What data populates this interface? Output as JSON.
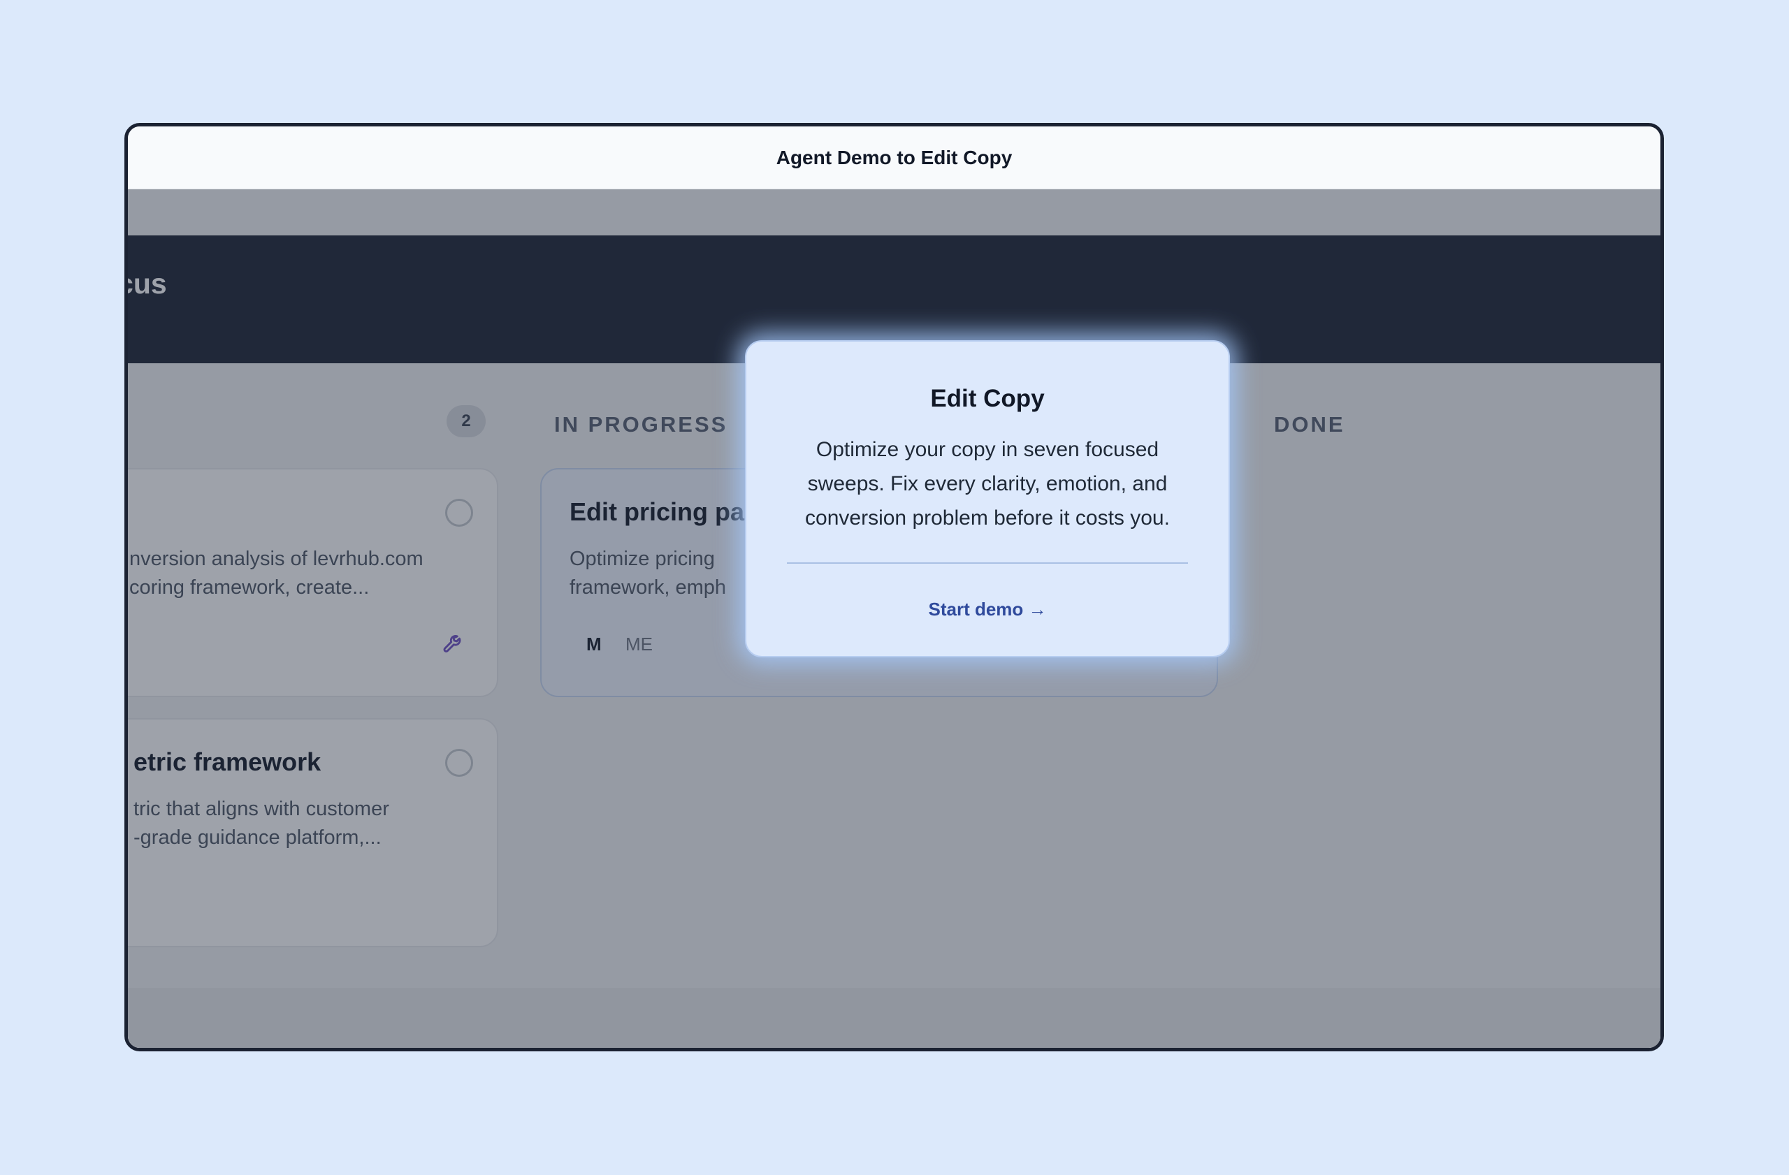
{
  "window": {
    "title": "Agent Demo to Edit Copy"
  },
  "app": {
    "title_fragment": "ocus"
  },
  "columns": [
    {
      "label": "",
      "count": "2"
    },
    {
      "label": "IN PROGRESS"
    },
    {
      "label": "DONE"
    }
  ],
  "cards": {
    "todo_1": {
      "title": "",
      "desc_line1": "nversion analysis of levrhub.com",
      "desc_line2": "coring framework, create..."
    },
    "todo_2": {
      "title": "etric framework",
      "desc_line1": "tric that aligns with customer",
      "desc_line2": "-grade guidance platform,..."
    },
    "in_progress_1": {
      "title": "Edit pricing pa",
      "desc_line1": "Optimize pricing",
      "desc_line2": "framework, emph",
      "tag_size": "M",
      "tag_owner": "ME"
    }
  },
  "modal": {
    "title": "Edit Copy",
    "body": "Optimize your copy in seven focused sweeps. Fix every clarity, emotion, and conversion problem before it costs you.",
    "cta": "Start demo →"
  },
  "icons": {
    "tool": "wrench-icon",
    "status": "circle-icon"
  },
  "colors": {
    "page_bg": "#dce9fb",
    "header_bg": "#1b2232",
    "modal_bg": "#dde9fc",
    "cta": "#2f4a9c",
    "accent_purple": "#6d4fc4"
  }
}
